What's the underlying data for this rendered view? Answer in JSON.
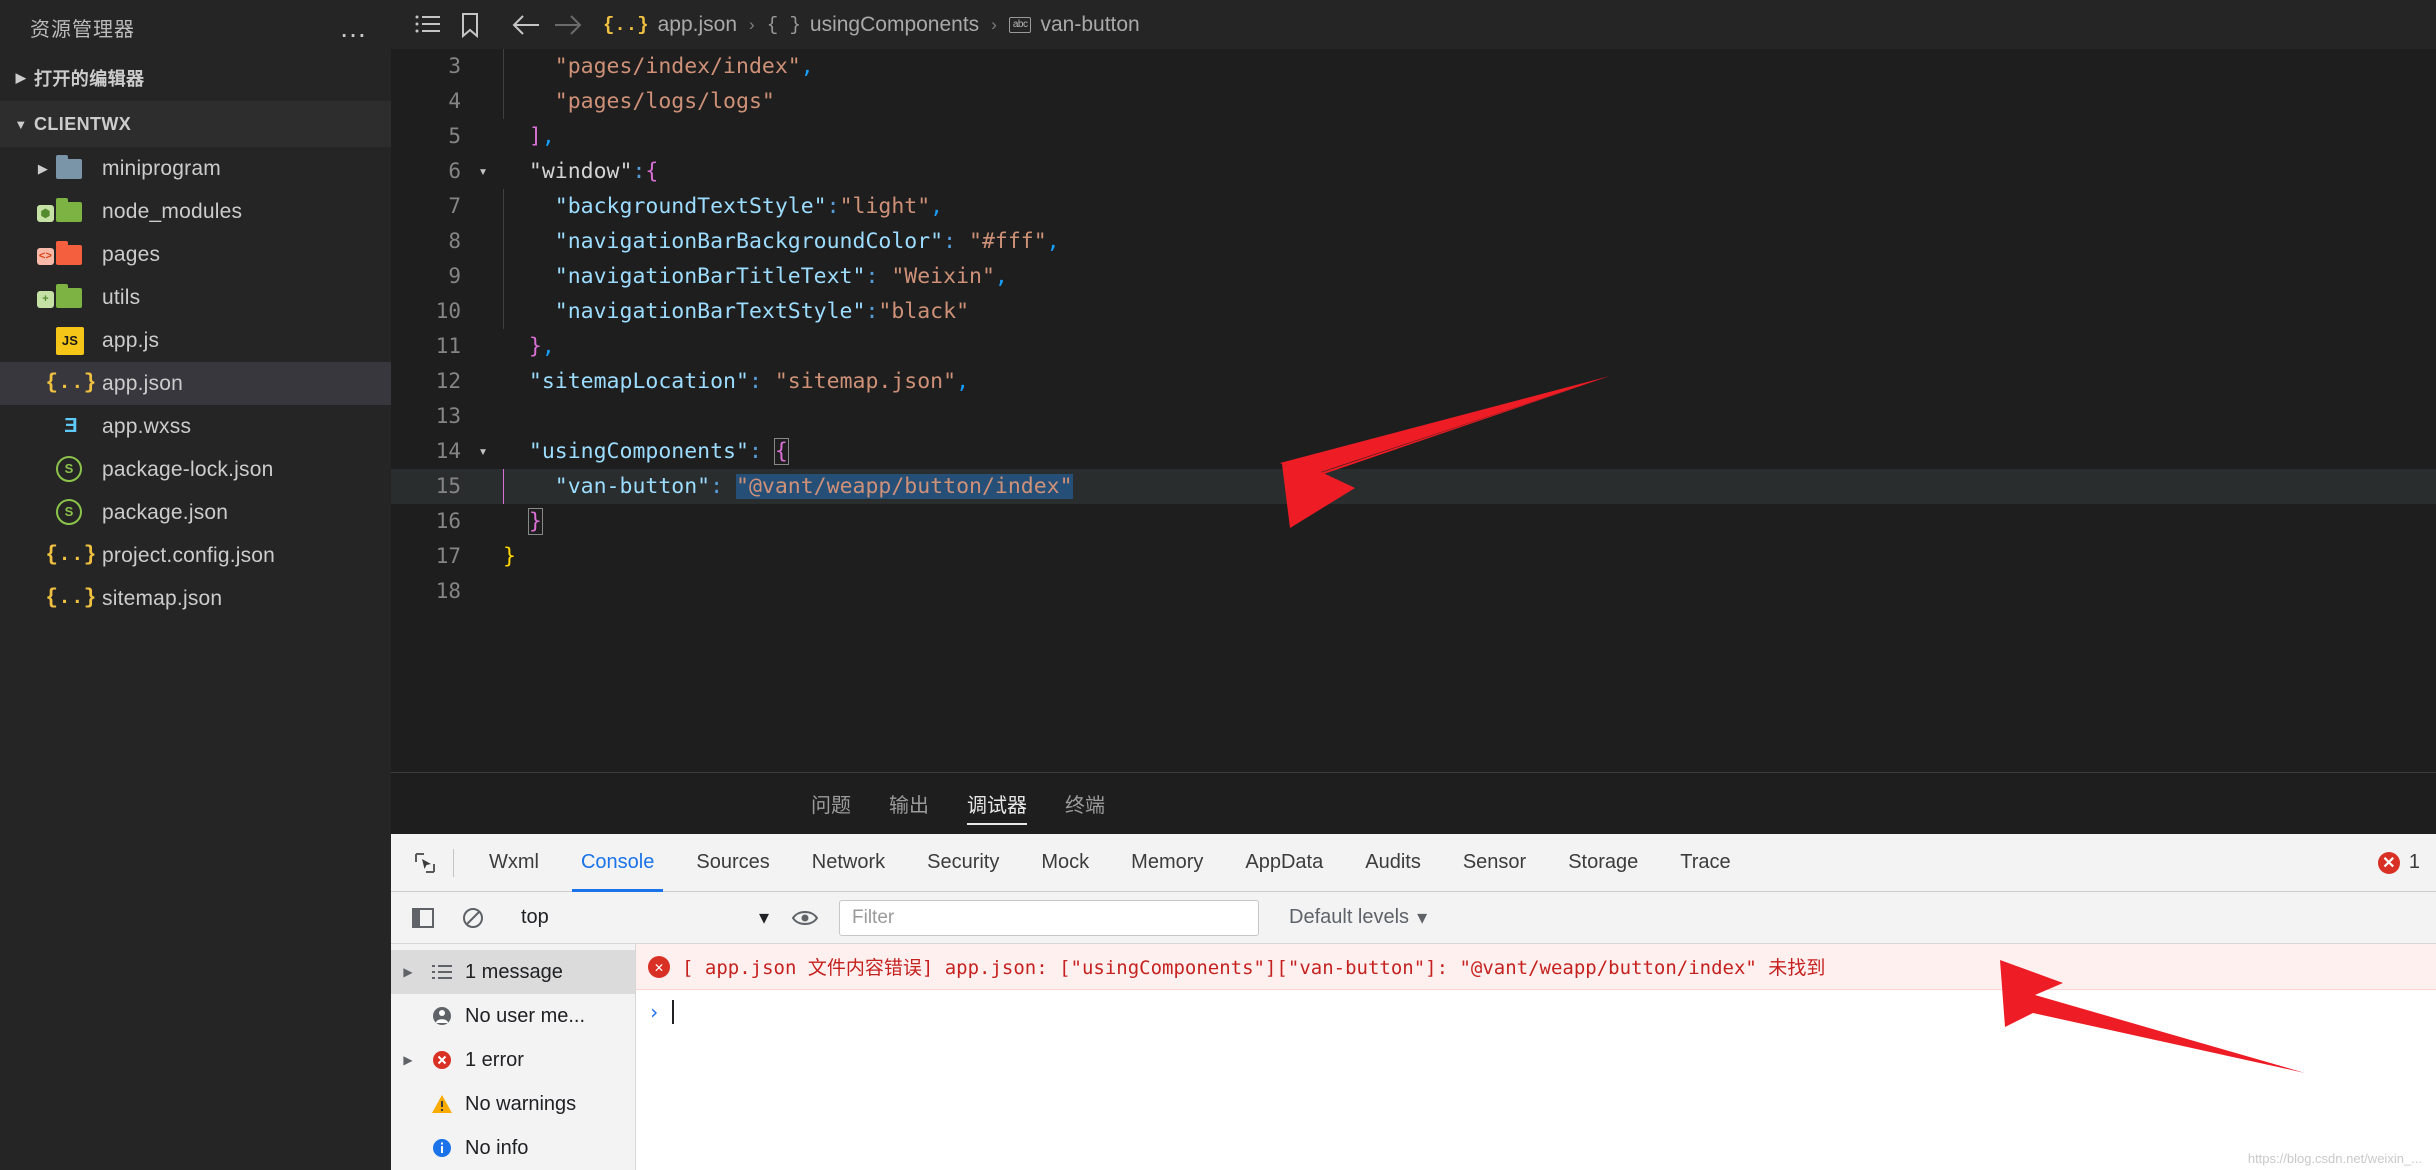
{
  "sidebar": {
    "title": "资源管理器",
    "more_icon": "ellipsis-icon",
    "sections": [
      {
        "label": "打开的编辑器",
        "expanded": false
      },
      {
        "label": "CLIENTWX",
        "expanded": true
      }
    ],
    "tree": [
      {
        "label": "miniprogram",
        "type": "folder",
        "icon": "folder-blue-icon",
        "expanded": false,
        "selected": false
      },
      {
        "label": "node_modules",
        "type": "folder",
        "icon": "folder-green-node-icon",
        "expanded": false,
        "selected": false
      },
      {
        "label": "pages",
        "type": "folder",
        "icon": "folder-red-code-icon",
        "expanded": false,
        "selected": false
      },
      {
        "label": "utils",
        "type": "folder",
        "icon": "folder-green-plus-icon",
        "expanded": false,
        "selected": false
      },
      {
        "label": "app.js",
        "type": "file",
        "icon": "js-file-icon",
        "selected": false
      },
      {
        "label": "app.json",
        "type": "file",
        "icon": "json-file-icon",
        "selected": true
      },
      {
        "label": "app.wxss",
        "type": "file",
        "icon": "wxss-file-icon",
        "selected": false
      },
      {
        "label": "package-lock.json",
        "type": "file",
        "icon": "npm-package-icon",
        "selected": false
      },
      {
        "label": "package.json",
        "type": "file",
        "icon": "npm-package-icon",
        "selected": false
      },
      {
        "label": "project.config.json",
        "type": "file",
        "icon": "json-file-icon",
        "selected": false
      },
      {
        "label": "sitemap.json",
        "type": "file",
        "icon": "json-file-icon",
        "selected": false
      }
    ]
  },
  "topbar": {
    "icons": [
      "list-icon",
      "bookmark-icon",
      "back-arrow-icon",
      "forward-arrow-icon"
    ],
    "breadcrumb": [
      {
        "label": "app.json",
        "icon": "json-file-icon"
      },
      {
        "label": "usingComponents",
        "icon": "object-braces-icon"
      },
      {
        "label": "van-button",
        "icon": "abc-property-icon"
      }
    ],
    "separator": "›"
  },
  "editor": {
    "lines": [
      {
        "num": "3",
        "fold": "",
        "highlighted": false,
        "indent": 2
      },
      {
        "num": "4",
        "fold": "",
        "highlighted": false,
        "indent": 2
      },
      {
        "num": "5",
        "fold": "",
        "highlighted": false,
        "indent": 1
      },
      {
        "num": "6",
        "fold": "chevron-down-icon",
        "highlighted": false,
        "indent": 1
      },
      {
        "num": "7",
        "fold": "",
        "highlighted": false,
        "indent": 2
      },
      {
        "num": "8",
        "fold": "",
        "highlighted": false,
        "indent": 2
      },
      {
        "num": "9",
        "fold": "",
        "highlighted": false,
        "indent": 2
      },
      {
        "num": "10",
        "fold": "",
        "highlighted": false,
        "indent": 2
      },
      {
        "num": "11",
        "fold": "",
        "highlighted": false,
        "indent": 1
      },
      {
        "num": "12",
        "fold": "",
        "highlighted": false,
        "indent": 1
      },
      {
        "num": "13",
        "fold": "",
        "highlighted": false,
        "indent": 0
      },
      {
        "num": "14",
        "fold": "chevron-down-icon",
        "highlighted": false,
        "indent": 1
      },
      {
        "num": "15",
        "fold": "",
        "highlighted": true,
        "indent": 2
      },
      {
        "num": "16",
        "fold": "",
        "highlighted": false,
        "indent": 1
      },
      {
        "num": "17",
        "fold": "",
        "highlighted": false,
        "indent": 0
      },
      {
        "num": "18",
        "fold": "",
        "highlighted": false,
        "indent": 0
      }
    ],
    "code": {
      "l3_str": "\"pages/index/index\"",
      "l3_comma": ",",
      "l4_str": "\"pages/logs/logs\"",
      "l5_brk": "]",
      "l5_comma": ",",
      "l6_key": "\"window\"",
      "l6_colon": ":",
      "l6_brk": "{",
      "l7_key": "\"backgroundTextStyle\"",
      "l7_colon": ":",
      "l7_val": "\"light\"",
      "l7_comma": ",",
      "l8_key": "\"navigationBarBackgroundColor\"",
      "l8_colon": ": ",
      "l8_val": "\"#fff\"",
      "l8_comma": ",",
      "l9_key": "\"navigationBarTitleText\"",
      "l9_colon": ": ",
      "l9_val": "\"Weixin\"",
      "l9_comma": ",",
      "l10_key": "\"navigationBarTextStyle\"",
      "l10_colon": ":",
      "l10_val": "\"black\"",
      "l11_brk": "}",
      "l11_comma": ",",
      "l12_key": "\"sitemapLocation\"",
      "l12_colon": ": ",
      "l12_val": "\"sitemap.json\"",
      "l12_comma": ",",
      "l14_key": "\"usingComponents\"",
      "l14_colon": ": ",
      "l14_brk": "{",
      "l15_key": "\"van-button\"",
      "l15_colon": ": ",
      "l15_val": "\"@vant/weapp/button/index\"",
      "l16_brk": "}",
      "l17_brk": "}"
    }
  },
  "panel": {
    "tabs": [
      {
        "label": "问题",
        "active": false
      },
      {
        "label": "输出",
        "active": false
      },
      {
        "label": "调试器",
        "active": true
      },
      {
        "label": "终端",
        "active": false
      }
    ]
  },
  "devtools": {
    "inspect_icon": "inspect-element-icon",
    "tabs": [
      {
        "label": "Wxml",
        "active": false
      },
      {
        "label": "Console",
        "active": true
      },
      {
        "label": "Sources",
        "active": false
      },
      {
        "label": "Network",
        "active": false
      },
      {
        "label": "Security",
        "active": false
      },
      {
        "label": "Mock",
        "active": false
      },
      {
        "label": "Memory",
        "active": false
      },
      {
        "label": "AppData",
        "active": false
      },
      {
        "label": "Audits",
        "active": false
      },
      {
        "label": "Sensor",
        "active": false
      },
      {
        "label": "Storage",
        "active": false
      },
      {
        "label": "Trace",
        "active": false
      }
    ],
    "error_badge_count": "1",
    "toolbar": {
      "sidebar_toggle_icon": "panel-toggle-icon",
      "clear_icon": "clear-console-icon",
      "context_value": "top",
      "context_caret": "▾",
      "eye_icon": "live-expression-eye-icon",
      "filter_placeholder": "Filter",
      "levels_label": "Default levels",
      "levels_caret": "▾"
    },
    "sidebar_items": [
      {
        "label": "1 message",
        "icon": "messages-list-icon",
        "arrow": "▶",
        "selected": true
      },
      {
        "label": "No user me...",
        "icon": "user-message-icon",
        "arrow": "",
        "selected": false
      },
      {
        "label": "1 error",
        "icon": "error-circle-icon",
        "arrow": "▶",
        "selected": false
      },
      {
        "label": "No warnings",
        "icon": "warning-triangle-icon",
        "arrow": "",
        "selected": false
      },
      {
        "label": "No info",
        "icon": "info-circle-icon",
        "arrow": "",
        "selected": false
      }
    ],
    "console_error": {
      "icon": "error-circle-icon",
      "text": "[ app.json 文件内容错误] app.json: [\"usingComponents\"][\"van-button\"]: \"@vant/weapp/button/index\"  未找到"
    },
    "prompt_symbol": "›"
  },
  "watermark": "https://blog.csdn.net/weixin_...",
  "annotations": {
    "arrow_color": "#ee1c25",
    "arrows": [
      {
        "name": "arrow-pointing-to-van-button-line"
      },
      {
        "name": "arrow-pointing-to-console-error"
      }
    ]
  }
}
